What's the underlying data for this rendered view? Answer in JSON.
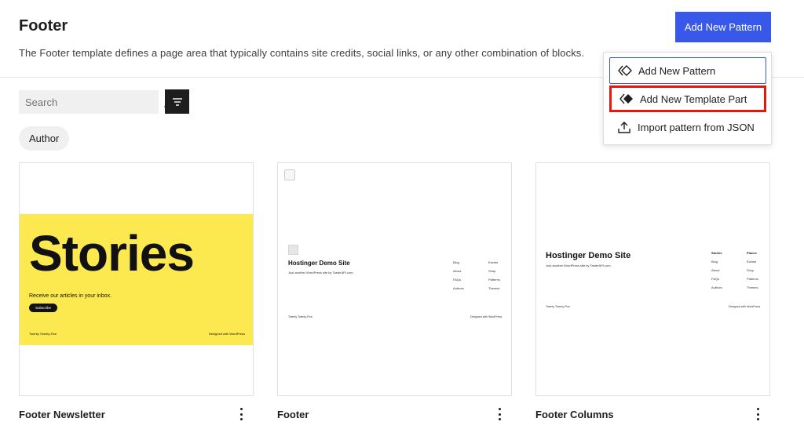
{
  "header": {
    "title": "Footer",
    "description": "The Footer template defines a page area that typically contains site credits, social links, or any other combination of blocks.",
    "add_button_label": "Add New Pattern"
  },
  "search": {
    "placeholder": "Search"
  },
  "filters": {
    "author_chip": "Author"
  },
  "dropdown": {
    "items": [
      {
        "label": "Add New Pattern",
        "icon": "pattern-outline-icon"
      },
      {
        "label": "Add New Template Part",
        "icon": "template-part-solid-icon"
      },
      {
        "label": "Import pattern from JSON",
        "icon": "upload-icon"
      }
    ]
  },
  "cards": [
    {
      "title": "Footer Newsletter",
      "preview": {
        "headline": "Stories",
        "subtext": "Receive our articles in your inbox.",
        "button": "Subscribe",
        "footer_left": "Twenty Twenty-Five",
        "footer_right": "Designed with WordPress"
      }
    },
    {
      "title": "Footer",
      "preview": {
        "site_name": "Hostinger Demo Site",
        "tagline": "Just another WordPress site by TasterAPI.com",
        "col1": [
          "Blog",
          "About",
          "FAQs",
          "Authors"
        ],
        "col2": [
          "Events",
          "Shop",
          "Patterns",
          "Themes"
        ],
        "footer_left": "Twenty Twenty-Five",
        "footer_right": "Designed with WordPress"
      }
    },
    {
      "title": "Footer Columns",
      "preview": {
        "site_name": "Hostinger Demo Site",
        "tagline": "Just another WordPress site by TasterAPI.com",
        "col1_heading": "Stories",
        "col1": [
          "Blog",
          "About",
          "FAQs",
          "Authors"
        ],
        "col2_heading": "Places",
        "col2": [
          "Events",
          "Shop",
          "Patterns",
          "Themes"
        ],
        "footer_left": "Twenty Twenty-Five",
        "footer_right": "Designed with WordPress"
      }
    }
  ],
  "colors": {
    "accent": "#3858e9",
    "highlight": "#e8170c",
    "newsletter_bg": "#fbe94f"
  }
}
